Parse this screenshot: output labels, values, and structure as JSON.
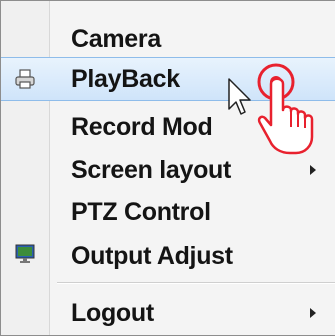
{
  "menu": {
    "items": [
      {
        "label": "Camera",
        "icon": "none",
        "submenu": false,
        "highlighted": false
      },
      {
        "label": "PlayBack",
        "icon": "printer-icon",
        "submenu": false,
        "highlighted": true
      },
      {
        "label": "Record Mod",
        "icon": "none",
        "submenu": false,
        "highlighted": false
      },
      {
        "label": "Screen layout",
        "icon": "none",
        "submenu": true,
        "highlighted": false
      },
      {
        "label": "PTZ Control",
        "icon": "none",
        "submenu": false,
        "highlighted": false
      },
      {
        "label": "Output Adjust",
        "icon": "monitor-icon",
        "submenu": false,
        "highlighted": false
      },
      {
        "label": "Logout",
        "icon": "none",
        "submenu": true,
        "highlighted": false
      }
    ]
  },
  "colors": {
    "highlight_top": "#e8f3fd",
    "highlight_bottom": "#cfe4fa",
    "highlight_border": "#8ebcea",
    "text": "#141414",
    "click_indicator": "#e8212e"
  }
}
